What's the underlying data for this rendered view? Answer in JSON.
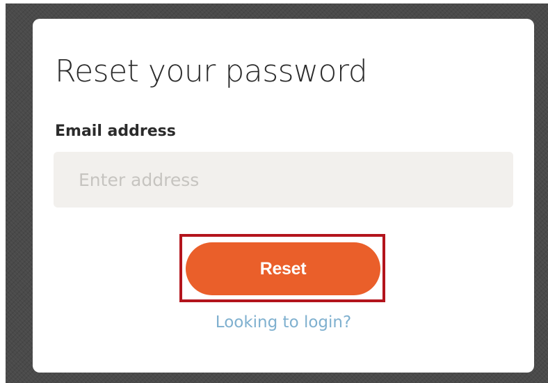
{
  "reset_form": {
    "title": "Reset your password",
    "email_label": "Email address",
    "email_value": "",
    "email_placeholder": "Enter address",
    "submit_label": "Reset",
    "login_link": "Looking to login?"
  },
  "colors": {
    "accent_button": "#ea5f2a",
    "highlight_border": "#b3141c",
    "link": "#7fb0cf",
    "input_background": "#f2f0ed",
    "backdrop": "#4a4a4a"
  }
}
